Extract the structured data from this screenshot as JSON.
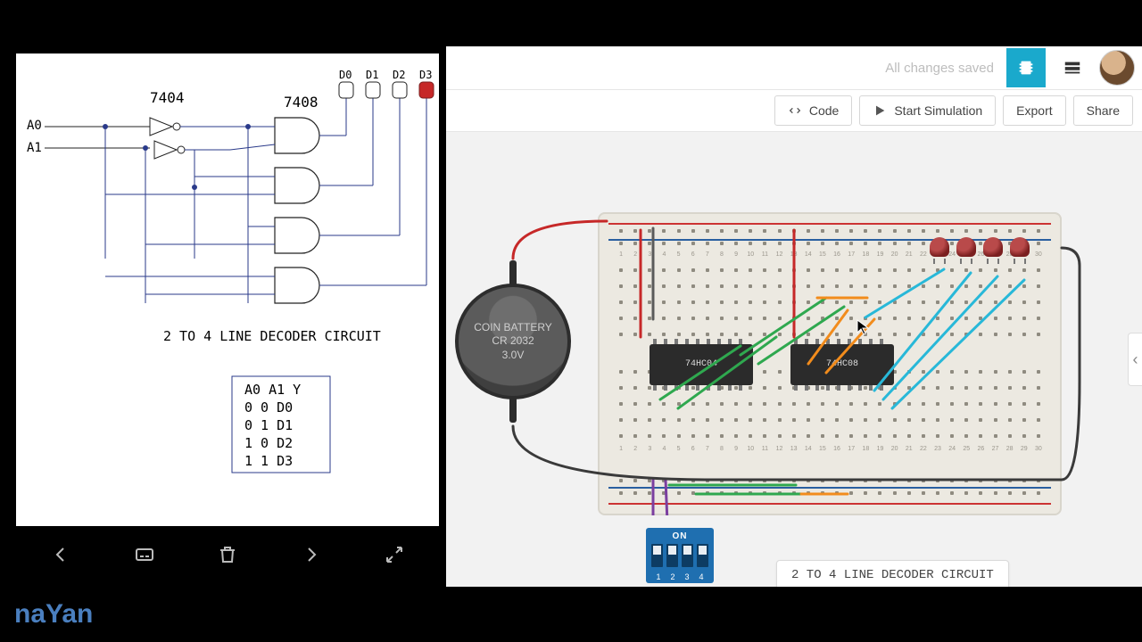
{
  "header": {
    "saved_status": "All changes saved"
  },
  "toolbar": {
    "code_label": "Code",
    "sim_label": "Start Simulation",
    "export_label": "Export",
    "share_label": "Share"
  },
  "canvas": {
    "title_bubble": "2 TO 4 LINE DECODER CIRCUIT",
    "chip1_label": "74HC04",
    "chip2_label": "74HC08",
    "battery_line1": "COIN BATTERY",
    "battery_line2": "CR 2032",
    "battery_line3": "3.0V",
    "dip_on": "ON",
    "dip_numbers": [
      "1",
      "2",
      "3",
      "4"
    ]
  },
  "schematic": {
    "title": "2 TO 4 LINE DECODER CIRCUIT",
    "ic_labels": {
      "inverter": "7404",
      "and": "7408"
    },
    "inputs": [
      "A0",
      "A1"
    ],
    "outputs": [
      "D0",
      "D1",
      "D2",
      "D3"
    ],
    "truth_table": {
      "headers": [
        "A0",
        "A1",
        "Y"
      ],
      "rows": [
        [
          "0",
          "0",
          "D0"
        ],
        [
          "0",
          "1",
          "D1"
        ],
        [
          "1",
          "0",
          "D2"
        ],
        [
          "1",
          "1",
          "D3"
        ]
      ]
    }
  },
  "watermark": "naYan"
}
